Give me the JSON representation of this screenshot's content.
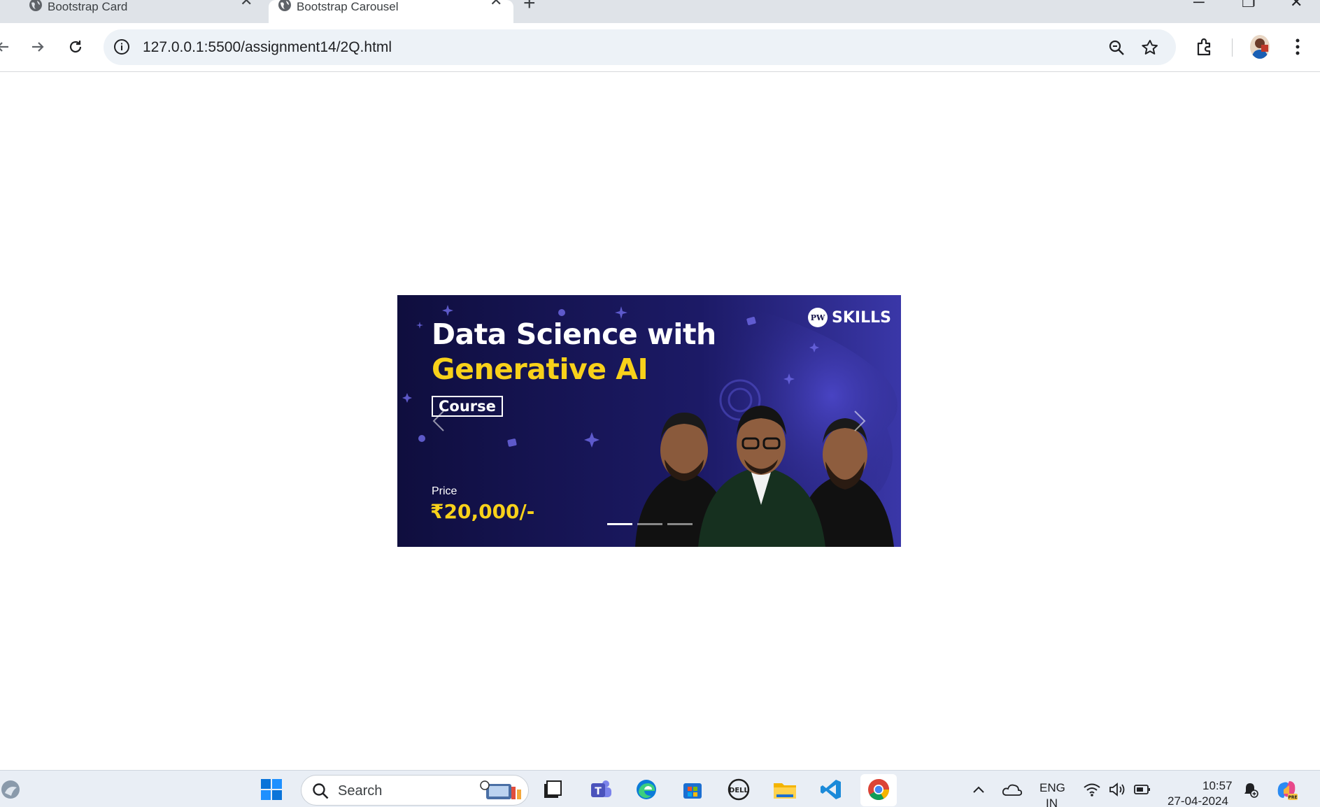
{
  "browser": {
    "tabs": [
      {
        "title": "Bootstrap Card",
        "active": false
      },
      {
        "title": "Bootstrap Carousel",
        "active": true
      }
    ],
    "new_tab": "+",
    "address": "127.0.0.1:5500/assignment14/2Q.html"
  },
  "carousel": {
    "brand": "SKILLS",
    "brand_logo": "PW",
    "title_line1": "Data Science with",
    "title_line2": "Generative AI",
    "tag": "Course",
    "price_label": "Price",
    "price": "₹20,000/-",
    "slide_count": 3,
    "active_index": 0,
    "colors": {
      "background": "#14134a",
      "accent": "#f8d11a"
    }
  },
  "taskbar": {
    "search_placeholder": "Search",
    "language": "ENG",
    "region": "IN",
    "time": "10:57",
    "date": "27-04-2024"
  }
}
